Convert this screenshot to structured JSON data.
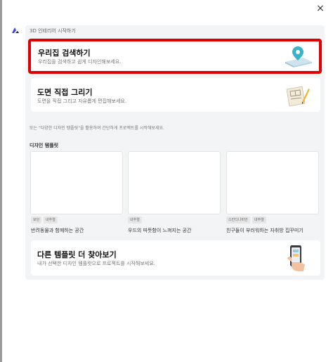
{
  "close_label": "×",
  "section_label": "3D 인테리어 시작하기",
  "search_card": {
    "title": "우리집 검색하기",
    "desc": "우리집을 검색하고 쉽게 디자인해보세요."
  },
  "draw_card": {
    "title": "도면 직접 그리기",
    "desc": "도면을 직접 그리고 자유롭게 편집해보세요."
  },
  "info_text": "또는 \"다양한 디자인 템플릿\"을 활용하여 간단하게 프로젝트를 시작해보세요.",
  "templates_label": "디자인 템플릿",
  "templates": [
    {
      "tags": [
        "모던",
        "내추럴"
      ],
      "title": "반려동물과 함께하는 공간"
    },
    {
      "tags": [
        "내추럴"
      ],
      "title": "우드의 따뜻함이 느껴지는 공간"
    },
    {
      "tags": [
        "스칸디나비안",
        "내추럴"
      ],
      "title": "친구들이 부러워하는 자취방 집꾸미기"
    }
  ],
  "more_card": {
    "title": "다른 템플릿 더 찾아보기",
    "desc": "내가 선택한 디자인 템플릿으로 프로젝트를 시작해보세요."
  },
  "colors": {
    "highlight": "#e10000",
    "accent": "#4a6cf7",
    "panel": "#f3f4f6"
  }
}
